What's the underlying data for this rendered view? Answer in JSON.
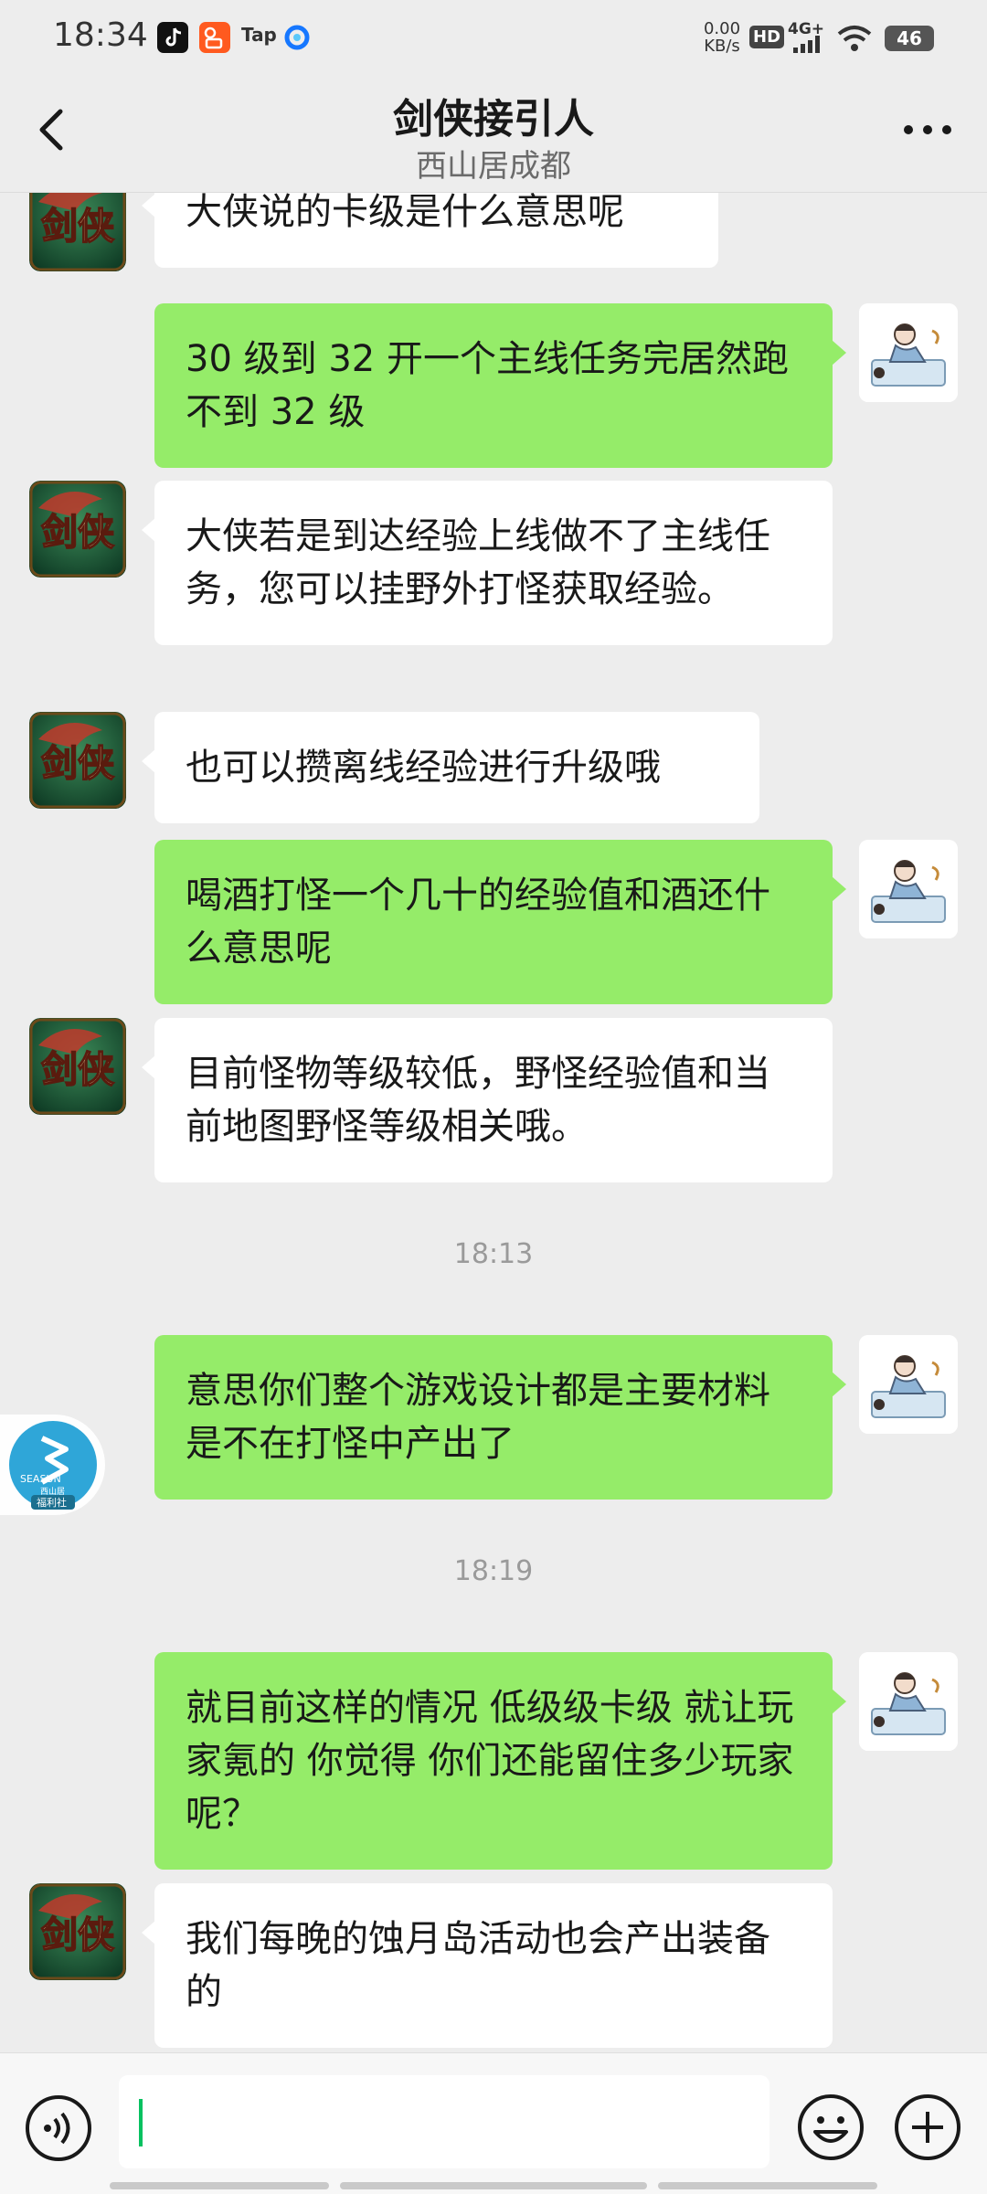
{
  "status_bar": {
    "time": "18:34",
    "net_speed_value": "0.00",
    "net_speed_unit": "KB/s",
    "hd": "HD",
    "signal": "4G+",
    "battery": "46",
    "tap_label": "Tap"
  },
  "header": {
    "title": "剑侠接引人",
    "subtitle": "西山居成都"
  },
  "messages": [
    {
      "side": "in",
      "text": "大侠说的卡级是什么意思呢"
    },
    {
      "side": "out",
      "text": "30 级到 32 开一个主线任务完居然跑不到 32 级"
    },
    {
      "side": "in",
      "text": "大侠若是到达经验上线做不了主线任务，您可以挂野外打怪获取经验。"
    },
    {
      "side": "in",
      "text": "也可以攒离线经验进行升级哦"
    },
    {
      "side": "out",
      "text": "喝酒打怪一个几十的经验值和酒还什么意思呢"
    },
    {
      "side": "in",
      "text": "目前怪物等级较低，野怪经验值和当前地图野怪等级相关哦。"
    },
    {
      "side": "time",
      "text": "18:13"
    },
    {
      "side": "out",
      "text": "意思你们整个游戏设计都是主要材料是不在打怪中产出了"
    },
    {
      "side": "time",
      "text": "18:19"
    },
    {
      "side": "out",
      "text": "就目前这样的情况 低级级卡级 就让玩家氪的  你觉得 你们还能留住多少玩家呢？"
    },
    {
      "side": "in",
      "text": "我们每晚的蚀月岛活动也会产出装备的"
    }
  ],
  "float_badge": {
    "brand": "SEASUN",
    "sub": "西山居",
    "label": "福利社"
  },
  "avatar_text": "剑侠",
  "colors": {
    "background": "#ededed",
    "bubble_out": "#95ec69",
    "bubble_in": "#ffffff",
    "caret": "#07c160"
  }
}
